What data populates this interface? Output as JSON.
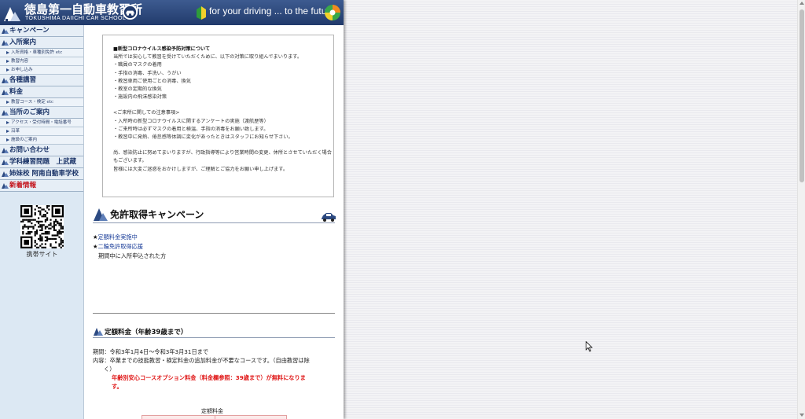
{
  "header": {
    "school_name": "徳島第一自動車教習所",
    "school_name_en": "TOKUSHIMA DAIICHI CAR SCHOOL",
    "slogan": "for your driving ... to the future"
  },
  "sidebar": {
    "items": [
      {
        "type": "main",
        "label": "キャンペーン"
      },
      {
        "type": "main",
        "label": "入所案内"
      },
      {
        "type": "sub",
        "label": "入所資格・車種別免許 etc"
      },
      {
        "type": "sub",
        "label": "教習内容"
      },
      {
        "type": "sub",
        "label": "お申し込み"
      },
      {
        "type": "main",
        "label": "各種講習"
      },
      {
        "type": "main",
        "label": "料金"
      },
      {
        "type": "sub",
        "label": "教習コース・検定 etc"
      },
      {
        "type": "main",
        "label": "当所のご案内"
      },
      {
        "type": "sub",
        "label": "アクセス・受付時間・電話番号"
      },
      {
        "type": "sub",
        "label": "沿革"
      },
      {
        "type": "sub",
        "label": "施設のご案内"
      },
      {
        "type": "main",
        "label": "お問い合わせ"
      },
      {
        "type": "main",
        "label": "学科練習問題　上武蔵"
      },
      {
        "type": "main",
        "label": "姉妹校 阿南自動車学校"
      },
      {
        "type": "main",
        "label": "新着情報",
        "accent": "red"
      }
    ],
    "qr_caption": "携帯サイト"
  },
  "notice": {
    "title": "■新型コロナウイルス感染予防対策について",
    "intro": "当所では安心して教習を受けていただくために、以下の対策に取り組んでまいります。",
    "measures": [
      "・職員のマスクの着用",
      "・手指の消毒、手洗い、うがい",
      "・教習車両ご使用ごとの消毒、換気",
      "・教室の定期的な換気",
      "・施設内の飛沫感染対策"
    ],
    "visitor_title": "<ご来所に関しての注意事項>",
    "visitor_items": [
      "・入所時の新型コロナウイルスに関するアンケートの実施（渡航歴等）",
      "・ご来所時は必ずマスクの着用と検温、手指の消毒をお願い致します。",
      "・教習中に発熱、倦怠感等体調に変化があったときはスタッフにお知らせ下さい。"
    ],
    "closing": [
      "尚、感染防止に努めてまいりますが、行政指導等により営業時間の変更、休所とさせていただく場合もございます。",
      "皆様には大変ご迷惑をおかけしますが、ご理解とご協力をお願い申し上げます。"
    ]
  },
  "campaign": {
    "title": "免許取得キャンペーン",
    "links": [
      "定額料金実施中",
      "二輪免許取得応援"
    ],
    "note": "期間中に入所申込された方"
  },
  "fee": {
    "title": "定額料金（年齢39歳まで）",
    "period": "期間：令和3年1月4日～令和3年3月31日まで",
    "content": "内容：卒業までの技能教習・検定料金の追加料金が不要なコースです。（自由教習は除",
    "content_cont": "く）",
    "highlight": "年齢別安心コースオプション料金（料金欄参照：39歳まで）が無料になりま",
    "highlight_cont": "す。",
    "table_caption": "定額料金"
  },
  "colors": {
    "header_top": "#3d5b90",
    "header_bottom": "#213a6b",
    "sidebar_bg": "#dce8f3",
    "nav_text": "#1b3468",
    "accent_red": "#e01a1a",
    "link_blue": "#1c3f9a"
  },
  "icons": [
    "mountain-logo-icon",
    "car-badge-icon",
    "beginner-leaf-icon",
    "globe-badge-icon",
    "nav-triangle-icon",
    "car-icon",
    "qr-code-icon",
    "cursor-icon"
  ]
}
